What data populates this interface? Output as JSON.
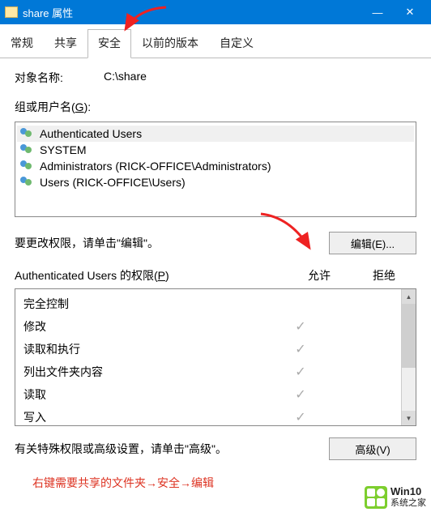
{
  "titlebar": {
    "title": "share 属性",
    "minimize": "—",
    "close": "✕"
  },
  "tabs": [
    {
      "label": "常规",
      "active": false
    },
    {
      "label": "共享",
      "active": false
    },
    {
      "label": "安全",
      "active": true
    },
    {
      "label": "以前的版本",
      "active": false
    },
    {
      "label": "自定义",
      "active": false
    }
  ],
  "object": {
    "label": "对象名称:",
    "value": "C:\\share"
  },
  "groups": {
    "label_pre": "组或用户名(",
    "label_u": "G",
    "label_post": "):",
    "items": [
      "Authenticated Users",
      "SYSTEM",
      "Administrators (RICK-OFFICE\\Administrators)",
      "Users (RICK-OFFICE\\Users)"
    ]
  },
  "edit": {
    "text": "要更改权限，请单击\"编辑\"。",
    "button": "编辑(E)..."
  },
  "perms": {
    "header_left_pre": "Authenticated Users 的权限(",
    "header_left_u": "P",
    "header_left_post": ")",
    "allow": "允许",
    "deny": "拒绝",
    "rows": [
      {
        "name": "完全控制",
        "allow": "",
        "deny": ""
      },
      {
        "name": "修改",
        "allow": "✓",
        "deny": ""
      },
      {
        "name": "读取和执行",
        "allow": "✓",
        "deny": ""
      },
      {
        "name": "列出文件夹内容",
        "allow": "✓",
        "deny": ""
      },
      {
        "name": "读取",
        "allow": "✓",
        "deny": ""
      },
      {
        "name": "写入",
        "allow": "✓",
        "deny": ""
      }
    ]
  },
  "advanced": {
    "text": "有关特殊权限或高级设置，请单击\"高级\"。",
    "button": "高级(V)"
  },
  "footer": "右键需要共享的文件夹→安全→编辑",
  "watermark": {
    "line1": "Win10",
    "line2": "系统之家"
  }
}
